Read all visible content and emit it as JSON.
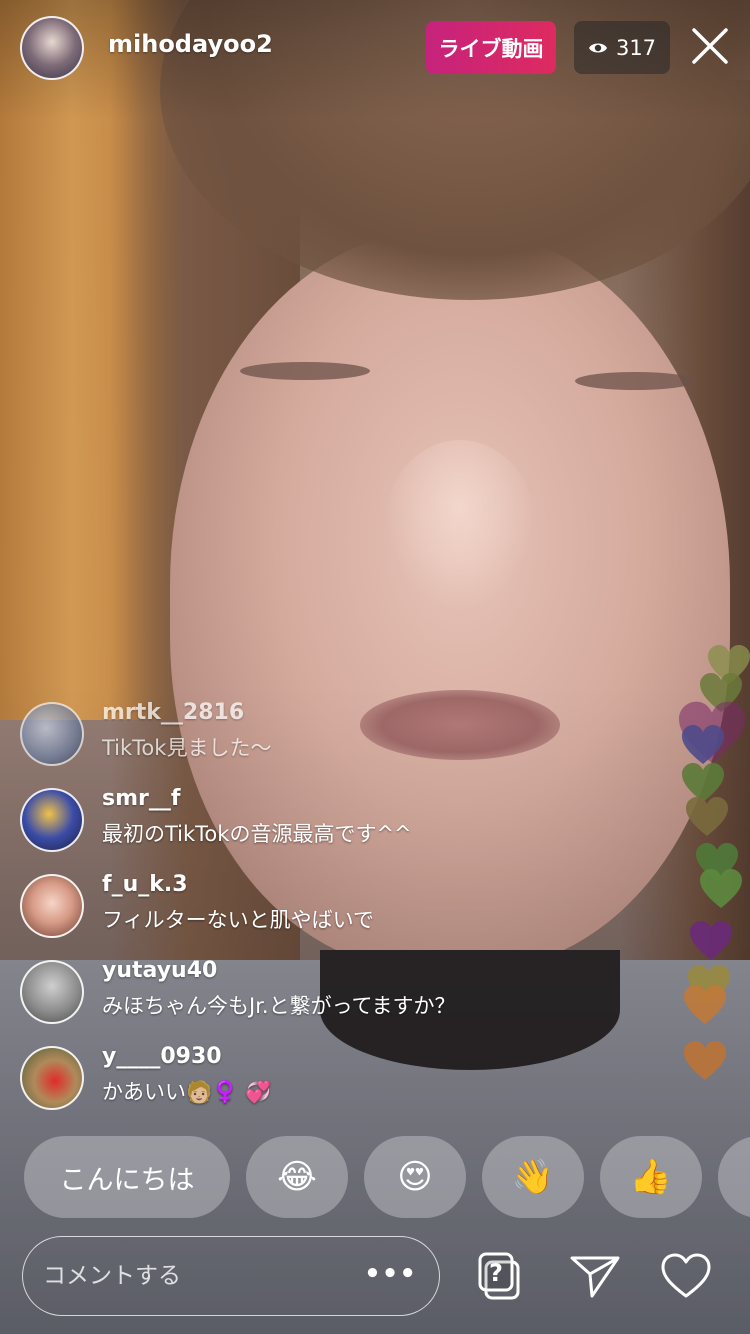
{
  "host": {
    "username": "mihodayoo2",
    "live_label": "ライブ動画",
    "viewer_count": "317"
  },
  "comments": [
    {
      "username": "mrtk__2816",
      "text": "TikTok見ました〜"
    },
    {
      "username": "smr__f",
      "text": "最初のTikTokの音源最高です^^"
    },
    {
      "username": "f_u_k.3",
      "text": "フィルターないと肌やばいで"
    },
    {
      "username": "yutayu40",
      "text": "みほちゃん今もJr.と繋がってますか？"
    },
    {
      "username": "y____0930",
      "text": "かあいい🧑🏼‍♀️ 💞"
    }
  ],
  "quick_replies": [
    "こんにちは",
    "😂",
    "😍",
    "👋",
    "👍"
  ],
  "composer": {
    "placeholder": "コメントする",
    "more": "•••"
  },
  "colors": {
    "live_badge": "#d42667",
    "hearts": [
      "#8a8f4e",
      "#6b7a3a",
      "#4f4a8a",
      "#5c7a3a",
      "#7a6a3e",
      "#4f7a3a",
      "#5c8a3e",
      "#6a2a7a",
      "#9a8a3a",
      "#c07a3a",
      "#b8743a"
    ]
  },
  "icons": [
    "eye-icon",
    "close-icon",
    "question-gallery-icon",
    "send-icon",
    "heart-icon"
  ]
}
